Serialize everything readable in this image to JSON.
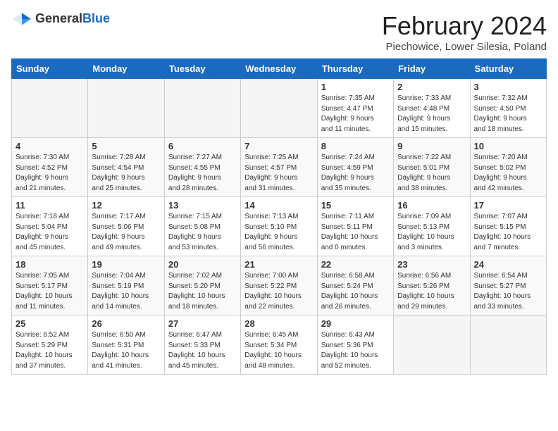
{
  "header": {
    "logo_general": "General",
    "logo_blue": "Blue",
    "title": "February 2024",
    "subtitle": "Piechowice, Lower Silesia, Poland"
  },
  "weekdays": [
    "Sunday",
    "Monday",
    "Tuesday",
    "Wednesday",
    "Thursday",
    "Friday",
    "Saturday"
  ],
  "weeks": [
    [
      {
        "day": "",
        "content": ""
      },
      {
        "day": "",
        "content": ""
      },
      {
        "day": "",
        "content": ""
      },
      {
        "day": "",
        "content": ""
      },
      {
        "day": "1",
        "content": "Sunrise: 7:35 AM\nSunset: 4:47 PM\nDaylight: 9 hours\nand 11 minutes."
      },
      {
        "day": "2",
        "content": "Sunrise: 7:33 AM\nSunset: 4:48 PM\nDaylight: 9 hours\nand 15 minutes."
      },
      {
        "day": "3",
        "content": "Sunrise: 7:32 AM\nSunset: 4:50 PM\nDaylight: 9 hours\nand 18 minutes."
      }
    ],
    [
      {
        "day": "4",
        "content": "Sunrise: 7:30 AM\nSunset: 4:52 PM\nDaylight: 9 hours\nand 21 minutes."
      },
      {
        "day": "5",
        "content": "Sunrise: 7:28 AM\nSunset: 4:54 PM\nDaylight: 9 hours\nand 25 minutes."
      },
      {
        "day": "6",
        "content": "Sunrise: 7:27 AM\nSunset: 4:55 PM\nDaylight: 9 hours\nand 28 minutes."
      },
      {
        "day": "7",
        "content": "Sunrise: 7:25 AM\nSunset: 4:57 PM\nDaylight: 9 hours\nand 31 minutes."
      },
      {
        "day": "8",
        "content": "Sunrise: 7:24 AM\nSunset: 4:59 PM\nDaylight: 9 hours\nand 35 minutes."
      },
      {
        "day": "9",
        "content": "Sunrise: 7:22 AM\nSunset: 5:01 PM\nDaylight: 9 hours\nand 38 minutes."
      },
      {
        "day": "10",
        "content": "Sunrise: 7:20 AM\nSunset: 5:02 PM\nDaylight: 9 hours\nand 42 minutes."
      }
    ],
    [
      {
        "day": "11",
        "content": "Sunrise: 7:18 AM\nSunset: 5:04 PM\nDaylight: 9 hours\nand 45 minutes."
      },
      {
        "day": "12",
        "content": "Sunrise: 7:17 AM\nSunset: 5:06 PM\nDaylight: 9 hours\nand 49 minutes."
      },
      {
        "day": "13",
        "content": "Sunrise: 7:15 AM\nSunset: 5:08 PM\nDaylight: 9 hours\nand 53 minutes."
      },
      {
        "day": "14",
        "content": "Sunrise: 7:13 AM\nSunset: 5:10 PM\nDaylight: 9 hours\nand 56 minutes."
      },
      {
        "day": "15",
        "content": "Sunrise: 7:11 AM\nSunset: 5:11 PM\nDaylight: 10 hours\nand 0 minutes."
      },
      {
        "day": "16",
        "content": "Sunrise: 7:09 AM\nSunset: 5:13 PM\nDaylight: 10 hours\nand 3 minutes."
      },
      {
        "day": "17",
        "content": "Sunrise: 7:07 AM\nSunset: 5:15 PM\nDaylight: 10 hours\nand 7 minutes."
      }
    ],
    [
      {
        "day": "18",
        "content": "Sunrise: 7:05 AM\nSunset: 5:17 PM\nDaylight: 10 hours\nand 11 minutes."
      },
      {
        "day": "19",
        "content": "Sunrise: 7:04 AM\nSunset: 5:19 PM\nDaylight: 10 hours\nand 14 minutes."
      },
      {
        "day": "20",
        "content": "Sunrise: 7:02 AM\nSunset: 5:20 PM\nDaylight: 10 hours\nand 18 minutes."
      },
      {
        "day": "21",
        "content": "Sunrise: 7:00 AM\nSunset: 5:22 PM\nDaylight: 10 hours\nand 22 minutes."
      },
      {
        "day": "22",
        "content": "Sunrise: 6:58 AM\nSunset: 5:24 PM\nDaylight: 10 hours\nand 26 minutes."
      },
      {
        "day": "23",
        "content": "Sunrise: 6:56 AM\nSunset: 5:26 PM\nDaylight: 10 hours\nand 29 minutes."
      },
      {
        "day": "24",
        "content": "Sunrise: 6:54 AM\nSunset: 5:27 PM\nDaylight: 10 hours\nand 33 minutes."
      }
    ],
    [
      {
        "day": "25",
        "content": "Sunrise: 6:52 AM\nSunset: 5:29 PM\nDaylight: 10 hours\nand 37 minutes."
      },
      {
        "day": "26",
        "content": "Sunrise: 6:50 AM\nSunset: 5:31 PM\nDaylight: 10 hours\nand 41 minutes."
      },
      {
        "day": "27",
        "content": "Sunrise: 6:47 AM\nSunset: 5:33 PM\nDaylight: 10 hours\nand 45 minutes."
      },
      {
        "day": "28",
        "content": "Sunrise: 6:45 AM\nSunset: 5:34 PM\nDaylight: 10 hours\nand 48 minutes."
      },
      {
        "day": "29",
        "content": "Sunrise: 6:43 AM\nSunset: 5:36 PM\nDaylight: 10 hours\nand 52 minutes."
      },
      {
        "day": "",
        "content": ""
      },
      {
        "day": "",
        "content": ""
      }
    ]
  ]
}
